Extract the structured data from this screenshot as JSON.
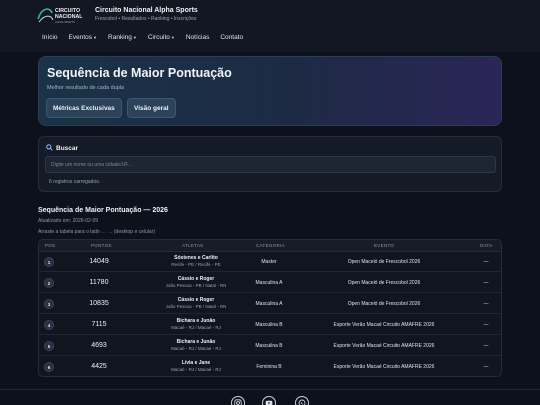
{
  "brand": {
    "logo_text_1": "CIRCUITO",
    "logo_text_2": "NACIONAL",
    "logo_text_3": "ALPHA SPORTS",
    "title": "Circuito Nacional Alpha Sports",
    "subtitle": "Frescobol • Resultados • Ranking • Inscrições"
  },
  "nav": {
    "items": [
      {
        "label": "Início",
        "dropdown": false
      },
      {
        "label": "Eventos",
        "dropdown": true
      },
      {
        "label": "Ranking",
        "dropdown": true
      },
      {
        "label": "Circuito",
        "dropdown": true
      },
      {
        "label": "Notícias",
        "dropdown": false
      },
      {
        "label": "Contato",
        "dropdown": false
      }
    ]
  },
  "hero": {
    "title": "Sequência de Maior Pontuação",
    "subtitle": "Melhor resultado de cada dupla",
    "buttons": [
      "Métricas Exclusivas",
      "Visão geral"
    ]
  },
  "search": {
    "title": "Buscar",
    "placeholder": "Digite um nome ou uma cidade/UF…",
    "count": "6 registros carregados."
  },
  "section": {
    "title": "Sequência de Maior Pontuação — 2026",
    "updated": "Atualizado em: 2026-02-09",
    "hint": "Arraste a tabela para o lado ← → (desktop e celular)"
  },
  "table": {
    "headers": [
      "POS",
      "PONTOS",
      "ATLETAS",
      "CATEGORIA",
      "EVENTO",
      "DATA"
    ],
    "rows": [
      {
        "pos": "1",
        "points": "14049",
        "athletes": "Sóstenes e Carlito",
        "location": "Recife - PE / Recife - PE",
        "category": "Master",
        "event": "Open Maceió de Frescobol 2026",
        "date": "—"
      },
      {
        "pos": "2",
        "points": "11780",
        "athletes": "Cássio e Roger",
        "location": "João Pessoa - PB / Natal - RN",
        "category": "Masculina A",
        "event": "Open Maceió de Frescobol 2026",
        "date": "—"
      },
      {
        "pos": "3",
        "points": "10835",
        "athletes": "Cássio e Roger",
        "location": "João Pessoa - PB / Natal - RN",
        "category": "Masculina A",
        "event": "Open Maceió de Frescobol 2026",
        "date": "—"
      },
      {
        "pos": "4",
        "points": "7115",
        "athletes": "Bichara e Junão",
        "location": "Macaé - RJ / Macaé - RJ",
        "category": "Masculina B",
        "event": "Esporte Verão Macaé Circuito AMAFRE 2026",
        "date": "—"
      },
      {
        "pos": "5",
        "points": "4693",
        "athletes": "Bichara e Junão",
        "location": "Macaé - RJ / Macaé - RJ",
        "category": "Masculina B",
        "event": "Esporte Verão Macaé Circuito AMAFRE 2026",
        "date": "—"
      },
      {
        "pos": "6",
        "points": "4425",
        "athletes": "Lívia e Jane",
        "location": "Macaé - RJ / Macaé - RJ",
        "category": "Feminina B",
        "event": "Esporte Verão Macaé Circuito AMAFRE 2026",
        "date": "—"
      }
    ]
  },
  "footer": {
    "social": [
      "instagram-icon",
      "youtube-icon",
      "whatsapp-icon"
    ]
  },
  "colors": {
    "background": "#0d111b",
    "accent_teal": "#2fb3a6",
    "hero_start": "#1a3347",
    "hero_end": "#2a2658"
  }
}
